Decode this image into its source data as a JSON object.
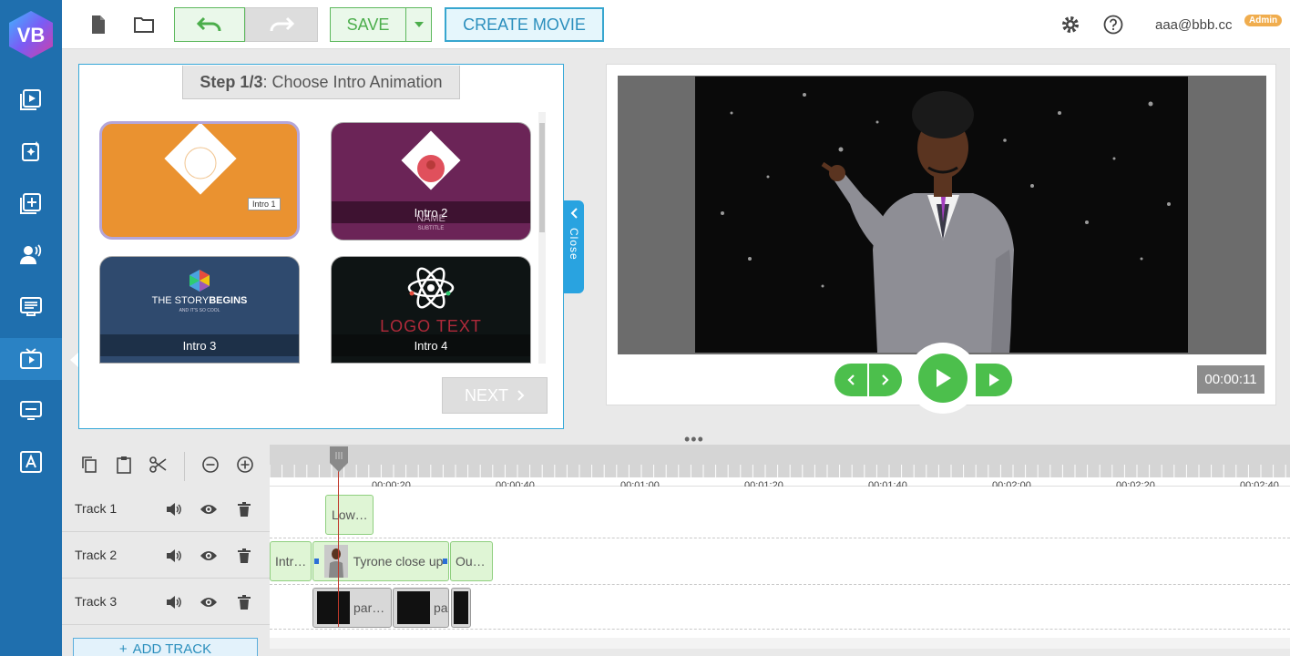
{
  "app": {
    "logo_text": "VB"
  },
  "topbar": {
    "save_label": "SAVE",
    "create_label": "CREATE MOVIE",
    "user_email": "aaa@bbb.cc",
    "admin_badge": "Admin"
  },
  "intro_panel": {
    "step_bold": "Step 1/3",
    "step_text": ": Choose Intro Animation",
    "items": [
      {
        "label": "Intro 1",
        "color": "#ea9230"
      },
      {
        "label": "Intro 2",
        "color": "#6b2457",
        "sub_name": "NAME",
        "sub_subtitle": "SUBTITLE"
      },
      {
        "label": "Intro 3",
        "color": "#2f4a6e",
        "headline_a": "THE STORY",
        "headline_b": "BEGINS",
        "tagline": "AND IT'S SO COOL"
      },
      {
        "label": "Intro 4",
        "color": "#0e1414",
        "logo_text": "LOGO TEXT"
      }
    ],
    "tooltip": "Intro 1",
    "next_label": "NEXT",
    "close_label": "Close"
  },
  "preview": {
    "time": "00:00:11"
  },
  "timeline": {
    "ticks": [
      "00:00:20",
      "00:00:40",
      "00:01:00",
      "00:01:20",
      "00:01:40",
      "00:02:00",
      "00:02:20",
      "00:02:40"
    ],
    "tracks": [
      {
        "name": "Track 1"
      },
      {
        "name": "Track 2"
      },
      {
        "name": "Track 3"
      }
    ],
    "clips": {
      "low": "Low…",
      "intro": "Intr…",
      "tyrone": "Tyrone close up",
      "outro": "Ou…",
      "par1": "par…",
      "par2": "pa"
    },
    "add_track_label": "ADD TRACK"
  },
  "colors": {
    "sidebar": "#1f6fae",
    "accent_green": "#4cbf4c",
    "accent_blue": "#29a3e0",
    "admin_badge": "#f0ad4e"
  }
}
